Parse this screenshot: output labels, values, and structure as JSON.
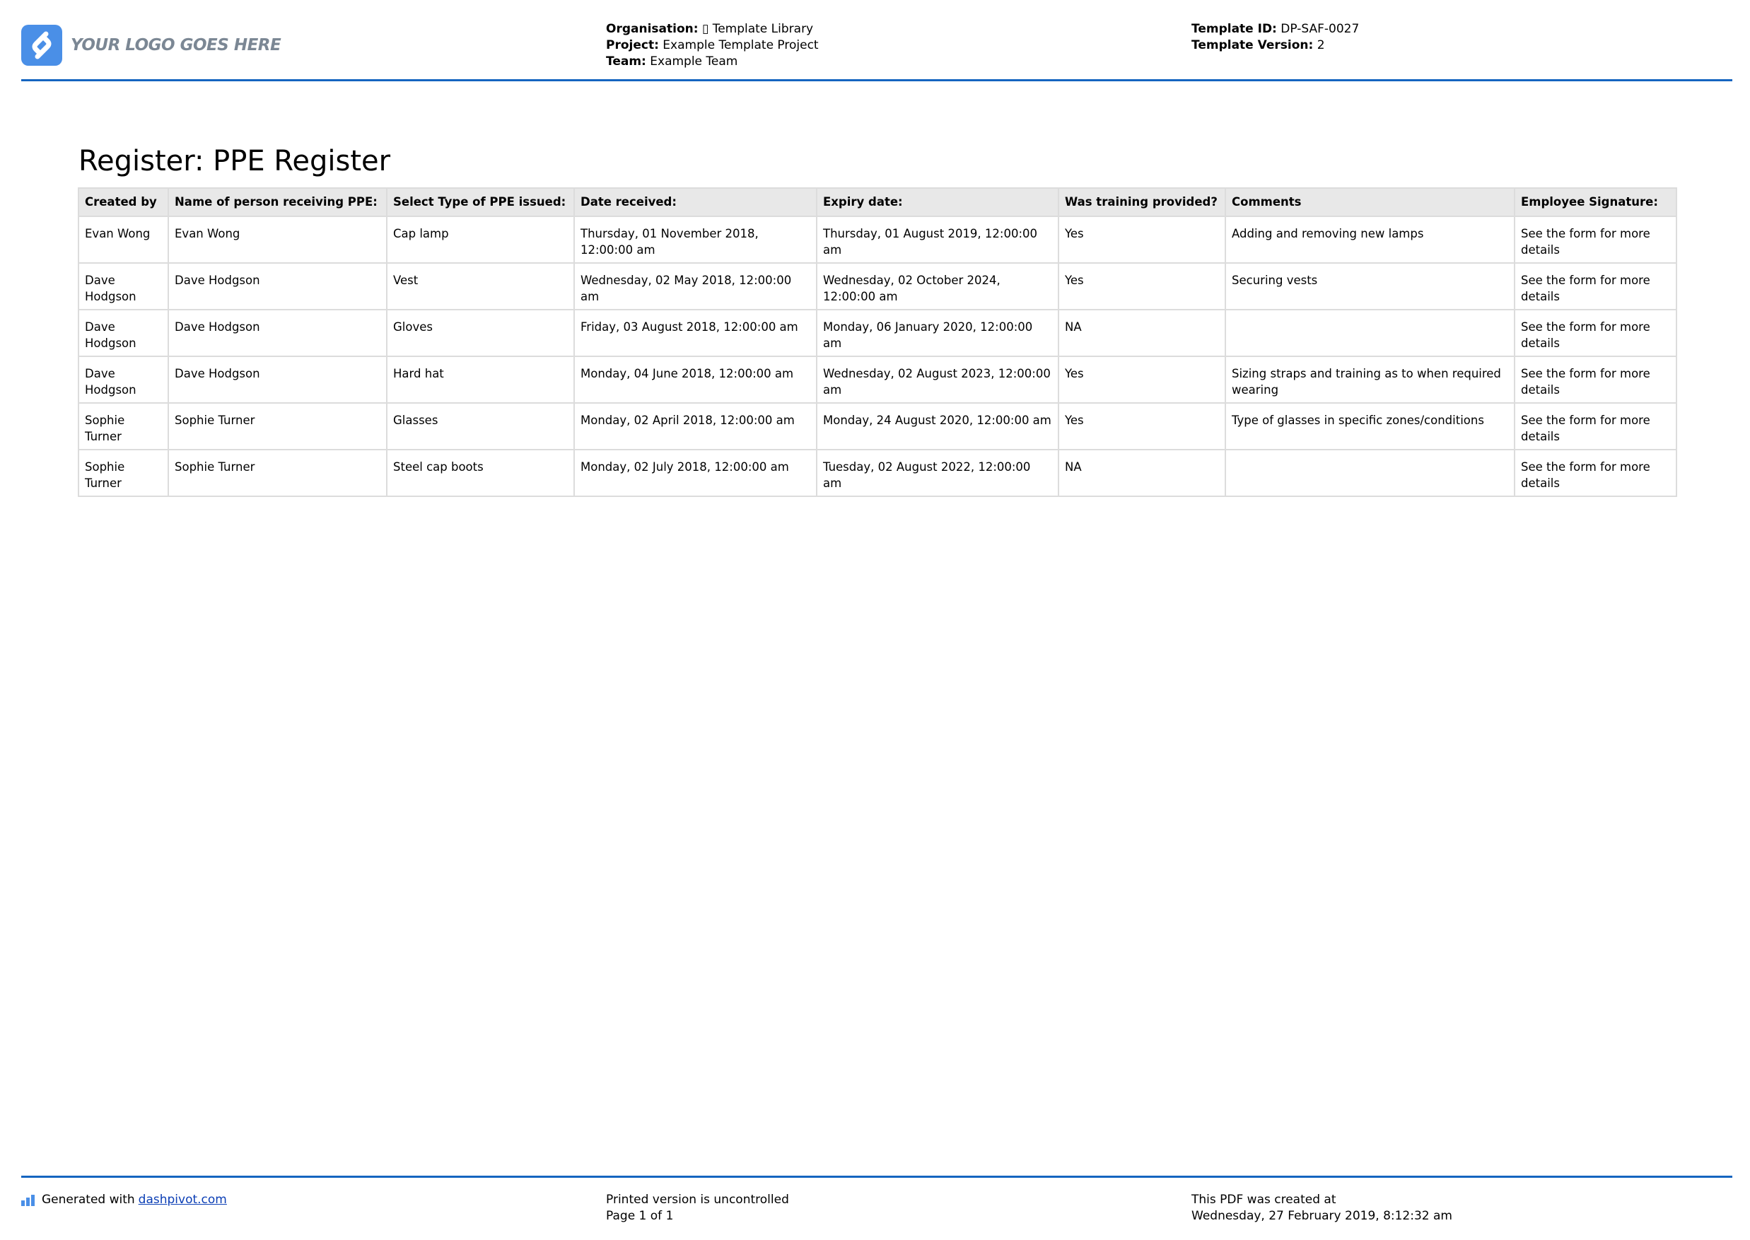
{
  "header": {
    "logo_text": "YOUR LOGO GOES HERE",
    "organisation_label": "Organisation:",
    "organisation_value": "▯ Template Library",
    "project_label": "Project:",
    "project_value": "Example Template Project",
    "team_label": "Team:",
    "team_value": "Example Team",
    "template_id_label": "Template ID:",
    "template_id_value": "DP-SAF-0027",
    "template_version_label": "Template Version:",
    "template_version_value": "2",
    "accent_color": "#1565c0",
    "logo_color": "#4a8fe7"
  },
  "title": "Register: PPE Register",
  "table": {
    "columns": [
      "Created by",
      "Name of person receiving PPE:",
      "Select Type of PPE issued:",
      "Date received:",
      "Expiry date:",
      "Was training provided?",
      "Comments",
      "Employee Signature:"
    ],
    "rows": [
      [
        "Evan Wong",
        "Evan Wong",
        "Cap lamp",
        "Thursday, 01 November 2018, 12:00:00 am",
        "Thursday, 01 August 2019, 12:00:00 am",
        "Yes",
        "Adding and removing new lamps",
        "See the form for more details"
      ],
      [
        "Dave Hodgson",
        "Dave Hodgson",
        "Vest",
        "Wednesday, 02 May 2018, 12:00:00 am",
        "Wednesday, 02 October 2024, 12:00:00 am",
        "Yes",
        "Securing vests",
        "See the form for more details"
      ],
      [
        "Dave Hodgson",
        "Dave Hodgson",
        "Gloves",
        "Friday, 03 August 2018, 12:00:00 am",
        "Monday, 06 January 2020, 12:00:00 am",
        "NA",
        "",
        "See the form for more details"
      ],
      [
        "Dave Hodgson",
        "Dave Hodgson",
        "Hard hat",
        "Monday, 04 June 2018, 12:00:00 am",
        "Wednesday, 02 August 2023, 12:00:00 am",
        "Yes",
        "Sizing straps and training as to when required wearing",
        "See the form for more details"
      ],
      [
        "Sophie Turner",
        "Sophie Turner",
        "Glasses",
        "Monday, 02 April 2018, 12:00:00 am",
        "Monday, 24 August 2020, 12:00:00 am",
        "Yes",
        "Type of glasses in specific zones/conditions",
        "See the form for more details"
      ],
      [
        "Sophie Turner",
        "Sophie Turner",
        "Steel cap boots",
        "Monday, 02 July 2018, 12:00:00 am",
        "Tuesday, 02 August 2022, 12:00:00 am",
        "NA",
        "",
        "See the form for more details"
      ]
    ]
  },
  "footer": {
    "generated_prefix": "Generated with",
    "generated_link": "dashpivot.com",
    "printed_notice": "Printed version is uncontrolled",
    "page_label": "Page 1 of 1",
    "created_label": "This PDF was created at",
    "created_value": "Wednesday, 27 February 2019, 8:12:32 am"
  }
}
